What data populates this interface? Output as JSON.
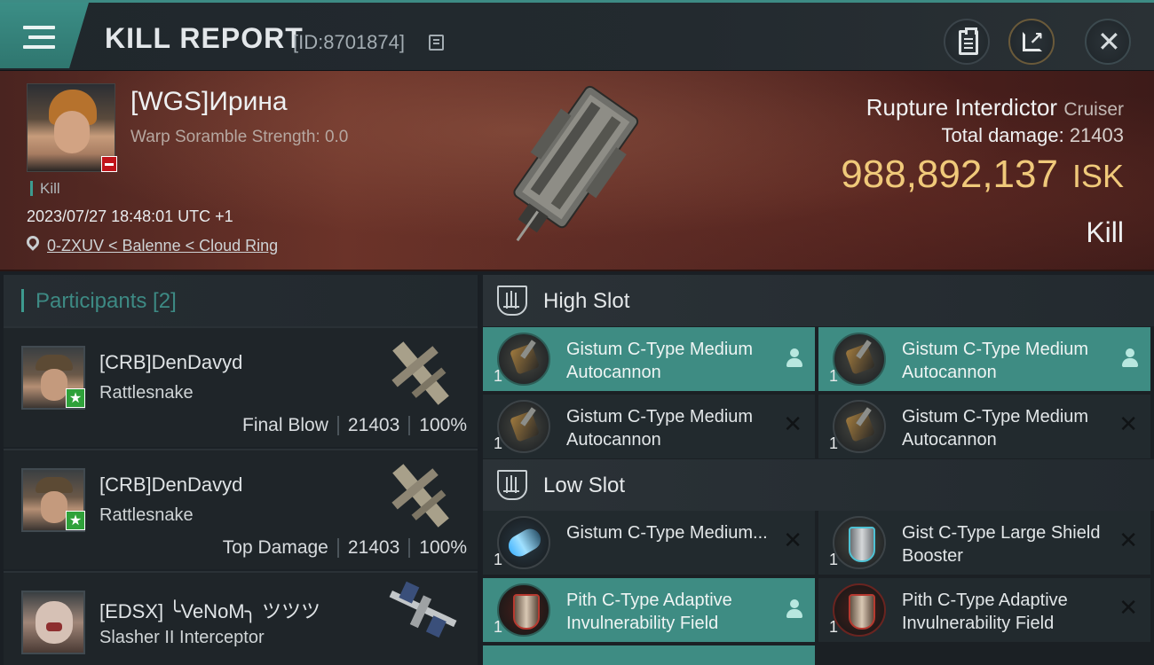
{
  "header": {
    "title": "KILL REPORT",
    "report_id": "[ID:8701874]",
    "icons": [
      "menu-icon",
      "copy-icon",
      "clipboard-icon",
      "share-icon",
      "close-icon"
    ]
  },
  "victim": {
    "name": "[WGS]Ирина",
    "scramble": "Warp Soramble Strength: 0.0",
    "tag": "Kill",
    "timestamp": "2023/07/27 18:48:01 UTC +1",
    "location": "0-ZXUV < Balenne < Cloud Ring",
    "ship": "Rupture Interdictor",
    "ship_class": "Cruiser",
    "total_damage_label": "Total damage:",
    "total_damage": "21403",
    "isk_value": "988,892,137",
    "isk_unit": "ISK",
    "result": "Kill"
  },
  "participants": {
    "header": "Participants [2]",
    "rows": [
      {
        "name": "[CRB]DenDavyd",
        "ship": "Rattlesnake",
        "role": "Final Blow",
        "damage": "21403",
        "percent": "100%"
      },
      {
        "name": "[CRB]DenDavyd",
        "ship": "Rattlesnake",
        "role": "Top Damage",
        "damage": "21403",
        "percent": "100%"
      },
      {
        "name": "[EDSX] ╰VeNoM╮ ツツツ",
        "ship": "Slasher II Interceptor"
      }
    ]
  },
  "slots": {
    "high": {
      "title": "High Slot",
      "modules": [
        {
          "qty": "1",
          "name": "Gistum C-Type Medium Autocannon",
          "status": "dropped"
        },
        {
          "qty": "1",
          "name": "Gistum C-Type Medium Autocannon",
          "status": "dropped"
        },
        {
          "qty": "1",
          "name": "Gistum C-Type Medium Autocannon",
          "status": "destroyed"
        },
        {
          "qty": "1",
          "name": "Gistum C-Type Medium Autocannon",
          "status": "destroyed"
        }
      ]
    },
    "low": {
      "title": "Low Slot",
      "modules": [
        {
          "qty": "1",
          "name": "Gistum C-Type Medium...",
          "status": "destroyed"
        },
        {
          "qty": "1",
          "name": "Gist C-Type Large Shield Booster",
          "status": "destroyed"
        },
        {
          "qty": "1",
          "name": "Pith C-Type Adaptive Invulnerability Field",
          "status": "dropped"
        },
        {
          "qty": "1",
          "name": "Pith C-Type Adaptive Invulnerability Field",
          "status": "destroyed"
        }
      ]
    }
  },
  "colors": {
    "accent": "#3d8b84",
    "isk": "#f0c97a",
    "highlight_row": "#3e8c83"
  }
}
